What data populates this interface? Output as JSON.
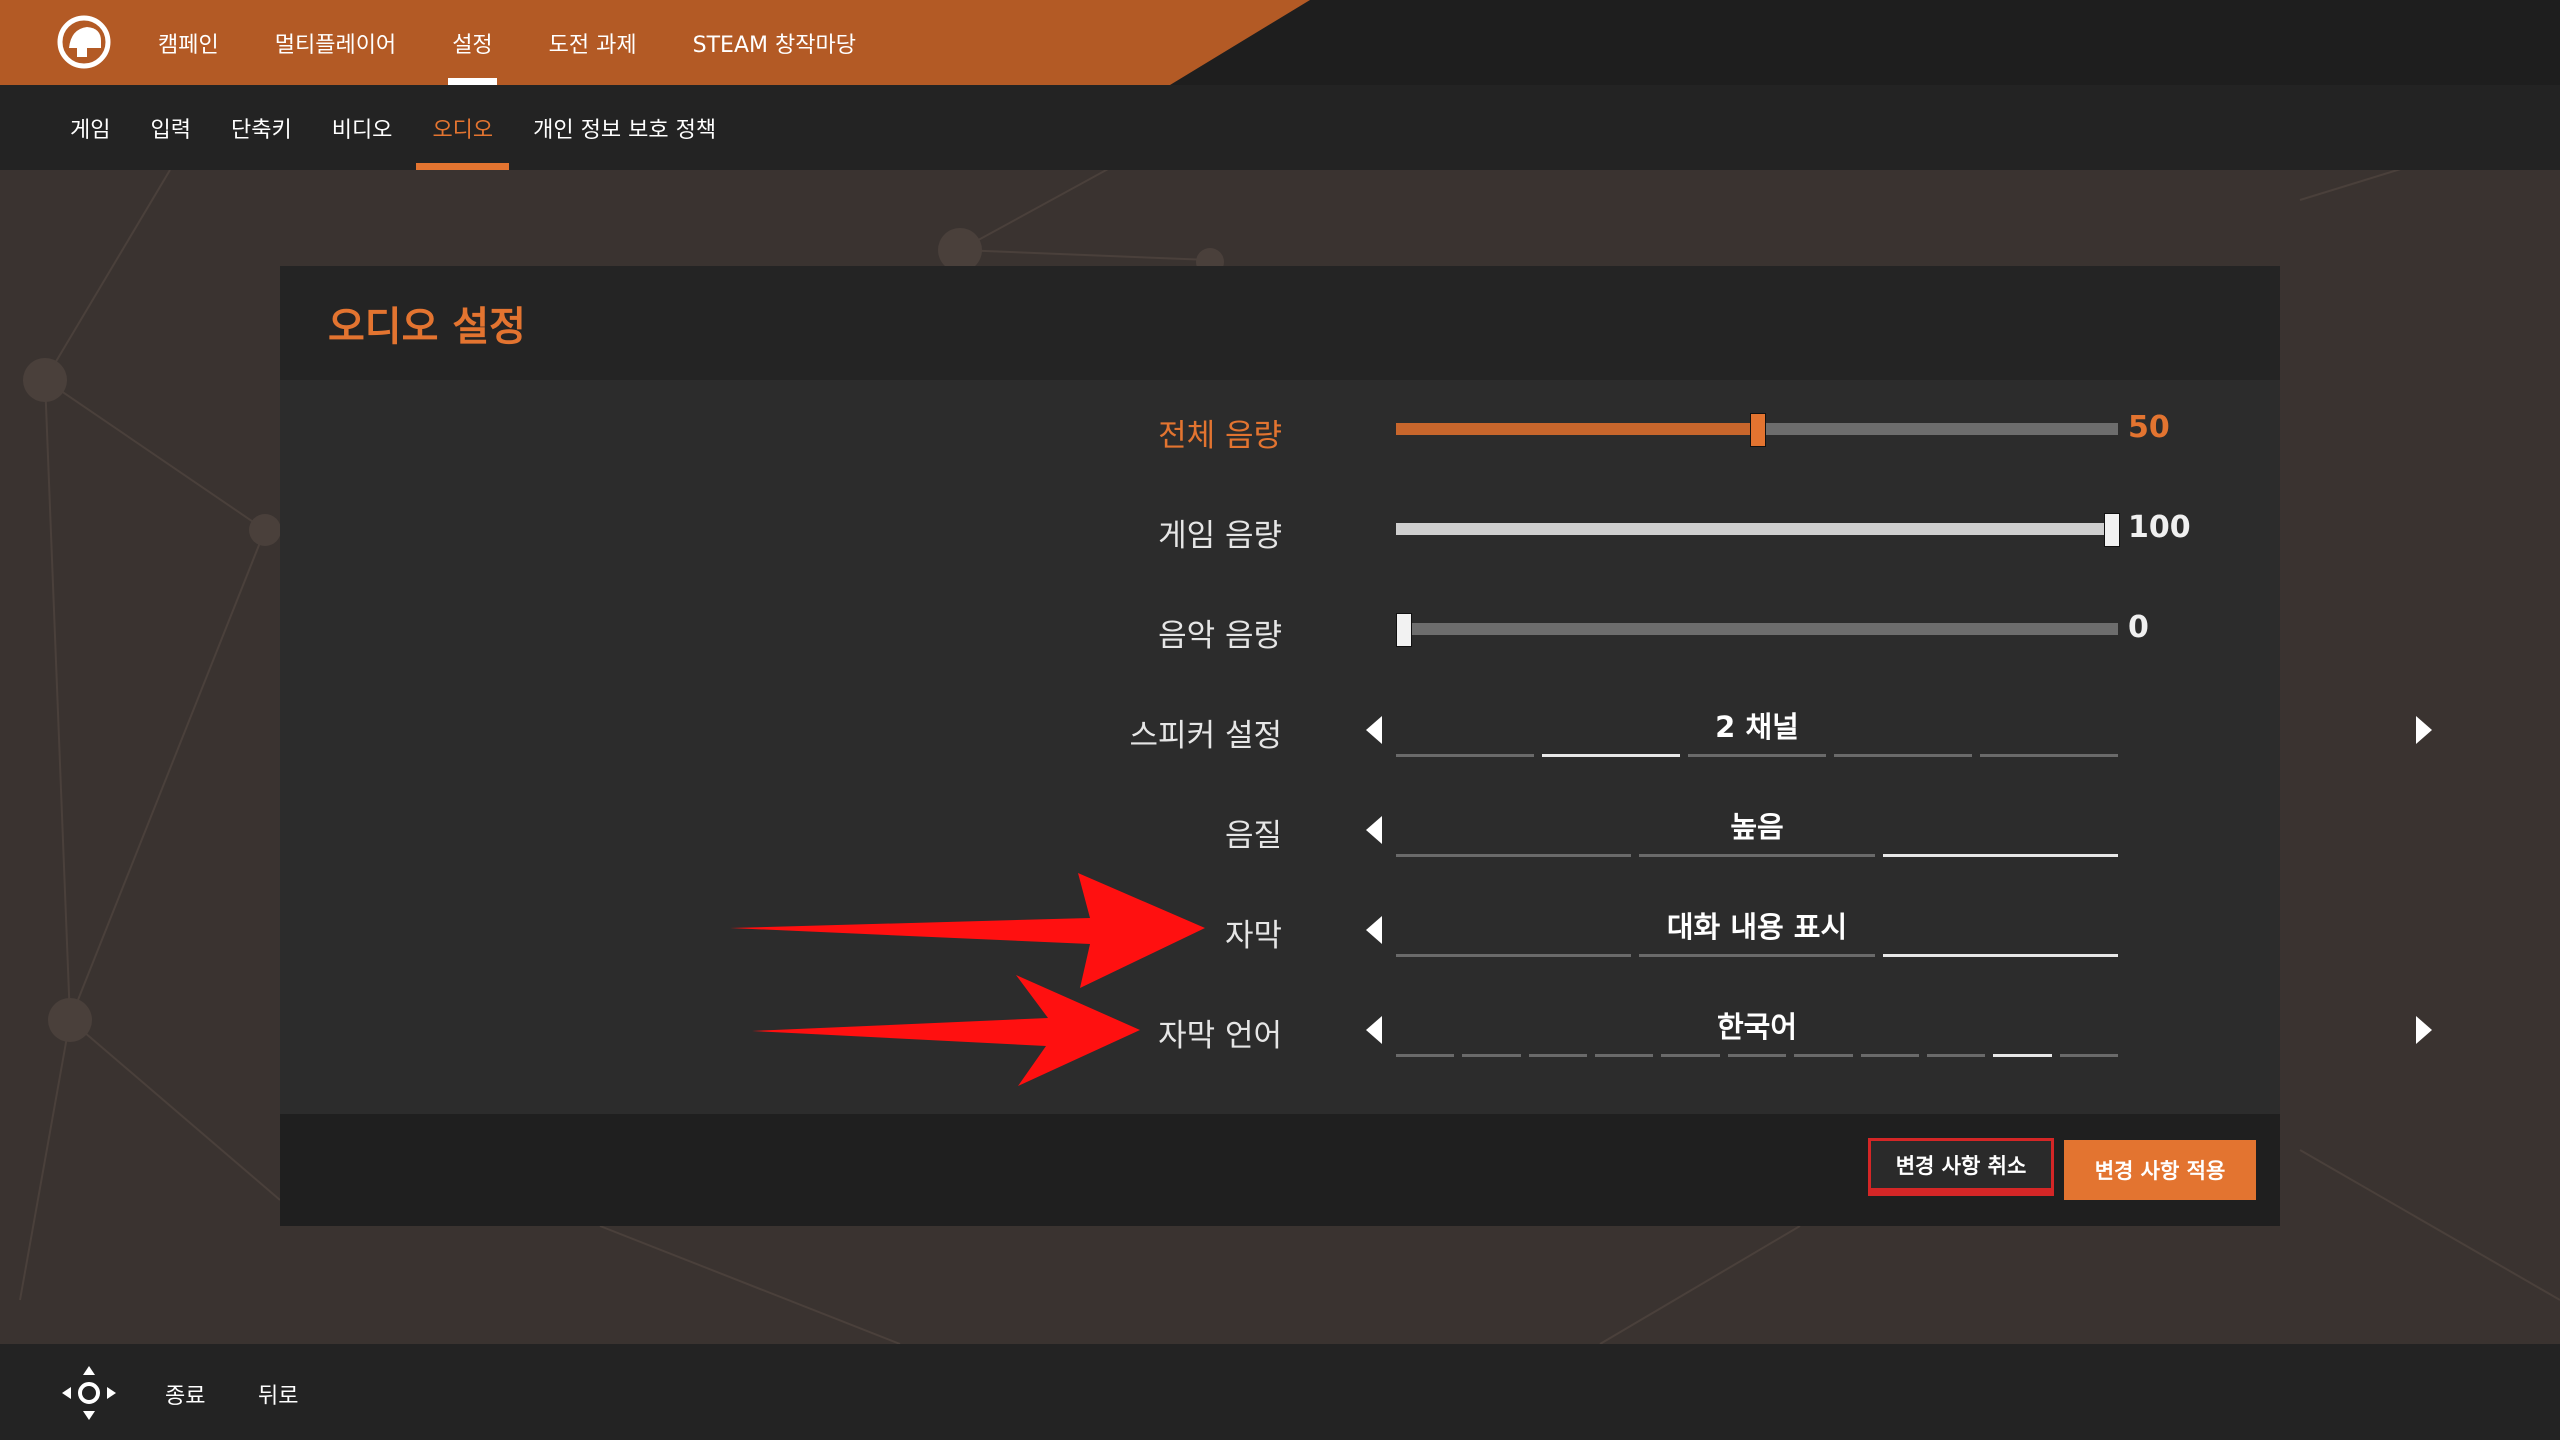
{
  "top_nav": {
    "items": [
      {
        "label": "캠페인"
      },
      {
        "label": "멀티플레이어"
      },
      {
        "label": "설정"
      },
      {
        "label": "도전 과제"
      },
      {
        "label": "STEAM 창작마당"
      }
    ],
    "active_index": 2
  },
  "sub_nav": {
    "items": [
      {
        "label": "게임"
      },
      {
        "label": "입력"
      },
      {
        "label": "단축키"
      },
      {
        "label": "비디오"
      },
      {
        "label": "오디오"
      },
      {
        "label": "개인 정보 보호 정책"
      }
    ],
    "active_index": 4
  },
  "panel": {
    "title": "오디오 설정",
    "sliders": [
      {
        "label": "전체 음량",
        "value": "50",
        "fraction": 0.5
      },
      {
        "label": "게임 음량",
        "value": "100",
        "fraction": 1.0
      },
      {
        "label": "음악 음량",
        "value": "0",
        "fraction": 0.0
      }
    ],
    "selectors": [
      {
        "label": "스피커 설정",
        "value": "2 채널",
        "segment_count": 5,
        "selected_segment": 1
      },
      {
        "label": "음질",
        "value": "높음",
        "segment_count": 3,
        "selected_segment": 2
      },
      {
        "label": "자막",
        "value": "대화 내용 표시",
        "segment_count": 3,
        "selected_segment": 2
      },
      {
        "label": "자막 언어",
        "value": "한국어",
        "segment_count": 11,
        "selected_segment": 9
      }
    ],
    "cancel_button": "변경 사항 취소",
    "apply_button": "변경 사항 적용"
  },
  "bottom_bar": {
    "quit_label": "종료",
    "back_label": "뒤로"
  },
  "icons": {
    "logo": "game-logo-icon",
    "dpad": "dpad-icon",
    "arrow_left": "arrow-left-icon",
    "arrow_right": "arrow-right-icon"
  },
  "colors": {
    "accent": "#e37430",
    "top_bar": "#b35a25",
    "annotation": "#ff1010"
  }
}
